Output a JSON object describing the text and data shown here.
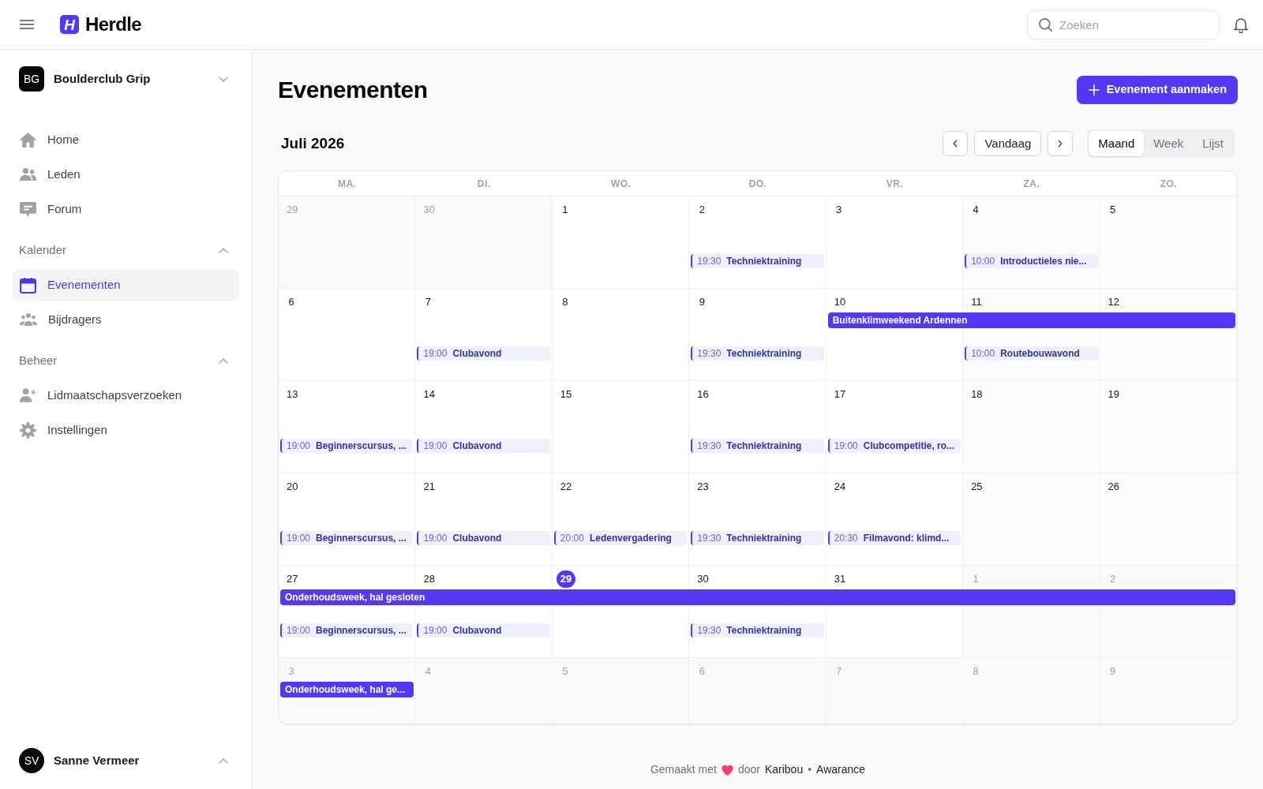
{
  "header": {
    "brand": {
      "mark": "H",
      "name": "Herdle"
    },
    "search": {
      "placeholder": "Zoeken"
    }
  },
  "sidebar": {
    "organization": {
      "initials": "BG",
      "name": "Boulderclub Grip"
    },
    "items": [
      {
        "kind": "home",
        "label": "Home",
        "selected": false
      },
      {
        "kind": "members",
        "label": "Leden",
        "selected": false
      },
      {
        "kind": "forum",
        "label": "Forum",
        "selected": false
      }
    ],
    "sections": [
      {
        "title": "Kalender",
        "expanded": true,
        "items": [
          {
            "kind": "calendar",
            "label": "Evenementen",
            "selected": true
          },
          {
            "kind": "contributors",
            "label": "Bijdragers",
            "selected": false
          }
        ]
      },
      {
        "title": "Beheer",
        "expanded": true,
        "items": [
          {
            "kind": "requests",
            "label": "Lidmaatschapsverzoeken",
            "selected": false
          },
          {
            "kind": "settings",
            "label": "Instellingen",
            "selected": false
          }
        ]
      }
    ],
    "user": {
      "initials": "SV",
      "name": "Sanne Vermeer"
    }
  },
  "page": {
    "title": "Evenementen",
    "create_button": "Evenement aanmaken"
  },
  "calendar": {
    "month": "Juli 2026",
    "today_button": "Vandaag",
    "views": [
      {
        "label": "Maand",
        "selected": true
      },
      {
        "label": "Week",
        "selected": false
      },
      {
        "label": "Lijst",
        "selected": false
      }
    ],
    "weekdays": [
      "MA.",
      "DI.",
      "WO.",
      "DO.",
      "VR.",
      "ZA.",
      "ZO."
    ],
    "weeks": [
      {
        "days": [
          {
            "day": "29",
            "in_month": false,
            "today": false
          },
          {
            "day": "30",
            "in_month": false,
            "today": false
          },
          {
            "day": "1",
            "in_month": true,
            "today": false
          },
          {
            "day": "2",
            "in_month": true,
            "today": false,
            "events": [
              {
                "time": "19:30",
                "title": "Techniektraining"
              }
            ]
          },
          {
            "day": "3",
            "in_month": true,
            "today": false
          },
          {
            "day": "4",
            "in_month": true,
            "today": false,
            "events": [
              {
                "time": "10:00",
                "title": "Introductieles nie..."
              }
            ]
          },
          {
            "day": "5",
            "in_month": true,
            "today": false
          }
        ]
      },
      {
        "days": [
          {
            "day": "6",
            "in_month": true,
            "today": false
          },
          {
            "day": "7",
            "in_month": true,
            "today": false,
            "events": [
              {
                "time": "19:00",
                "title": "Clubavond"
              }
            ]
          },
          {
            "day": "8",
            "in_month": true,
            "today": false
          },
          {
            "day": "9",
            "in_month": true,
            "today": false,
            "events": [
              {
                "time": "19:30",
                "title": "Techniektraining"
              }
            ]
          },
          {
            "day": "10",
            "in_month": true,
            "today": false,
            "bar": {
              "kind": "start",
              "title": "Buitenklimweekend Ardennen"
            }
          },
          {
            "day": "11",
            "in_month": true,
            "today": false,
            "bar": {
              "kind": "continue"
            },
            "events": [
              {
                "time": "10:00",
                "title": "Routebouwavond"
              }
            ]
          },
          {
            "day": "12",
            "in_month": true,
            "today": false,
            "bar": {
              "kind": "continue"
            }
          }
        ]
      },
      {
        "days": [
          {
            "day": "13",
            "in_month": true,
            "today": false,
            "events": [
              {
                "time": "19:00",
                "title": "Beginnerscursus, ..."
              }
            ]
          },
          {
            "day": "14",
            "in_month": true,
            "today": false,
            "events": [
              {
                "time": "19:00",
                "title": "Clubavond"
              }
            ]
          },
          {
            "day": "15",
            "in_month": true,
            "today": false
          },
          {
            "day": "16",
            "in_month": true,
            "today": false,
            "events": [
              {
                "time": "19:30",
                "title": "Techniektraining"
              }
            ]
          },
          {
            "day": "17",
            "in_month": true,
            "today": false,
            "events": [
              {
                "time": "19:00",
                "title": "Clubcompetitie, ro..."
              }
            ]
          },
          {
            "day": "18",
            "in_month": true,
            "today": false
          },
          {
            "day": "19",
            "in_month": true,
            "today": false
          }
        ]
      },
      {
        "days": [
          {
            "day": "20",
            "in_month": true,
            "today": false,
            "events": [
              {
                "time": "19:00",
                "title": "Beginnerscursus, ..."
              }
            ]
          },
          {
            "day": "21",
            "in_month": true,
            "today": false,
            "events": [
              {
                "time": "19:00",
                "title": "Clubavond"
              }
            ]
          },
          {
            "day": "22",
            "in_month": true,
            "today": false,
            "events": [
              {
                "time": "20:00",
                "title": "Ledenvergadering"
              }
            ]
          },
          {
            "day": "23",
            "in_month": true,
            "today": false,
            "events": [
              {
                "time": "19:30",
                "title": "Techniektraining"
              }
            ]
          },
          {
            "day": "24",
            "in_month": true,
            "today": false,
            "events": [
              {
                "time": "20:30",
                "title": "Filmavond: klimd..."
              }
            ]
          },
          {
            "day": "25",
            "in_month": true,
            "today": false
          },
          {
            "day": "26",
            "in_month": true,
            "today": false
          }
        ]
      },
      {
        "days": [
          {
            "day": "27",
            "in_month": true,
            "today": false,
            "bar": {
              "kind": "start",
              "title": "Onderhoudsweek, hal gesloten"
            },
            "events": [
              {
                "time": "19:00",
                "title": "Beginnerscursus, ..."
              }
            ]
          },
          {
            "day": "28",
            "in_month": true,
            "today": false,
            "bar": {
              "kind": "continue"
            },
            "events": [
              {
                "time": "19:00",
                "title": "Clubavond"
              }
            ]
          },
          {
            "day": "29",
            "in_month": true,
            "today": true,
            "bar": {
              "kind": "continue"
            }
          },
          {
            "day": "30",
            "in_month": true,
            "today": false,
            "bar": {
              "kind": "continue"
            },
            "events": [
              {
                "time": "19:30",
                "title": "Techniektraining"
              }
            ]
          },
          {
            "day": "31",
            "in_month": true,
            "today": false,
            "bar": {
              "kind": "continue"
            }
          },
          {
            "day": "1",
            "in_month": false,
            "today": false,
            "bar": {
              "kind": "continue"
            }
          },
          {
            "day": "2",
            "in_month": false,
            "today": false,
            "bar": {
              "kind": "continue"
            }
          }
        ]
      },
      {
        "days": [
          {
            "day": "3",
            "in_month": false,
            "today": false,
            "bar": {
              "kind": "start",
              "title": "Onderhoudsweek, hal ge..."
            }
          },
          {
            "day": "4",
            "in_month": false,
            "today": false
          },
          {
            "day": "5",
            "in_month": false,
            "today": false
          },
          {
            "day": "6",
            "in_month": false,
            "today": false
          },
          {
            "day": "7",
            "in_month": false,
            "today": false
          },
          {
            "day": "8",
            "in_month": false,
            "today": false
          },
          {
            "day": "9",
            "in_month": false,
            "today": false
          }
        ]
      }
    ]
  },
  "footer": {
    "made_with": "Gemaakt met",
    "by": "door",
    "links": [
      "Karibou",
      "Awarance"
    ],
    "separator": "•"
  }
}
